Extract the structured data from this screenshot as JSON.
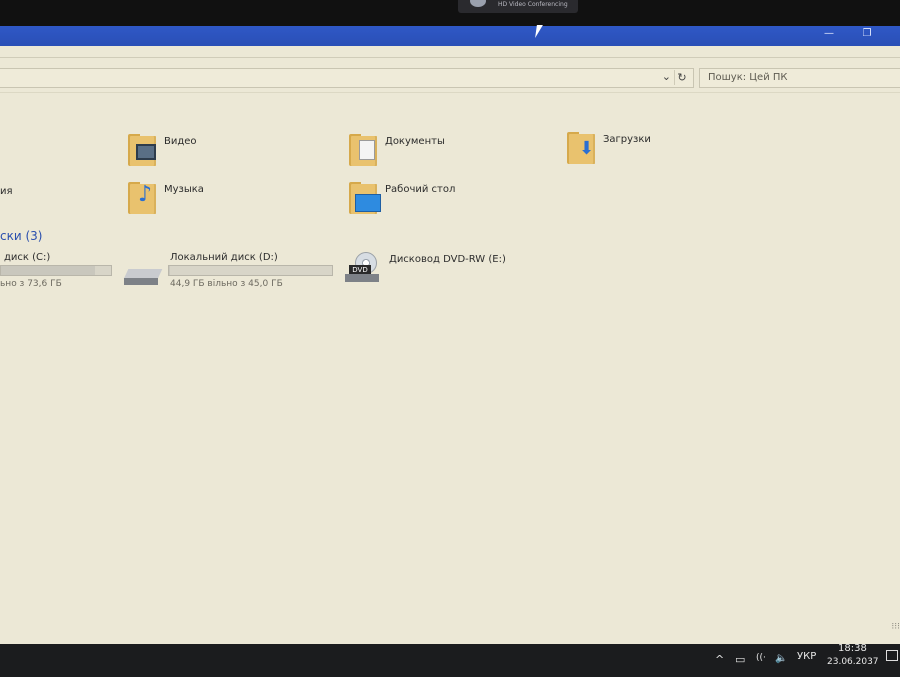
{
  "webcam_overlay": {
    "label": "HD Video Conferencing"
  },
  "titlebar": {
    "minimize_glyph": "—",
    "maximize_glyph": "❐"
  },
  "address": {
    "dropdown_glyph": "⌄",
    "refresh_glyph": "↻"
  },
  "search": {
    "placeholder": "Пошук: Цей ПК"
  },
  "folders": [
    {
      "label": "Видео",
      "icon": "video-folder-icon"
    },
    {
      "label": "Документы",
      "icon": "documents-folder-icon"
    },
    {
      "label": "Загрузки",
      "icon": "downloads-folder-icon"
    },
    {
      "label": "ия",
      "icon": "pictures-folder-icon"
    },
    {
      "label": "Музыка",
      "icon": "music-folder-icon"
    },
    {
      "label": "Рабочий стол",
      "icon": "desktop-folder-icon"
    }
  ],
  "devices_section": {
    "title": "ски (3)"
  },
  "drives": [
    {
      "name": "диск (C:)",
      "free": "ьно з 73,6 ГБ",
      "usage_fraction": 0.85
    },
    {
      "name": "Локальний диск (D:)",
      "free": "44,9 ГБ вільно з 45,0 ГБ",
      "usage_fraction": 0.003
    },
    {
      "name": "Дисковод DVD-RW (E:)",
      "icon_label": "DVD"
    }
  ],
  "resize_grip": "⁝⁝⁝",
  "taskbar": {
    "tray_chevron": "^",
    "tray_battery": "▭",
    "tray_network": "((·",
    "tray_volume": "🔈",
    "language": "УКР",
    "time": "18:38",
    "date": "23.06.2037"
  }
}
